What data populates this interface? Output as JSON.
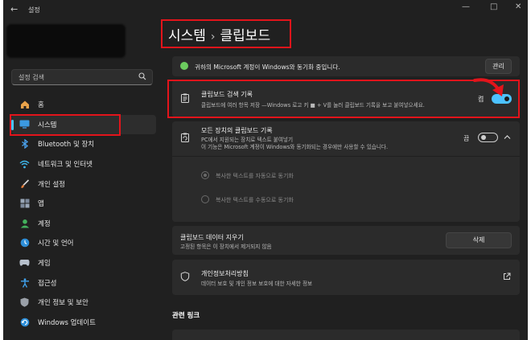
{
  "window": {
    "back": "←",
    "title": "설정",
    "controls": [
      "—",
      "□",
      "✕"
    ]
  },
  "search": {
    "placeholder": "설정 검색"
  },
  "sidebar": {
    "items": [
      {
        "label": "홈",
        "icon": "home-icon"
      },
      {
        "label": "시스템",
        "icon": "system-icon",
        "active": true
      },
      {
        "label": "Bluetooth 및 장치",
        "icon": "bluetooth-icon"
      },
      {
        "label": "네트워크 및 인터넷",
        "icon": "network-icon"
      },
      {
        "label": "개인 설정",
        "icon": "brush-icon"
      },
      {
        "label": "앱",
        "icon": "apps-icon"
      },
      {
        "label": "계정",
        "icon": "account-icon"
      },
      {
        "label": "시간 및 언어",
        "icon": "time-language-icon"
      },
      {
        "label": "게임",
        "icon": "gaming-icon"
      },
      {
        "label": "접근성",
        "icon": "accessibility-icon"
      },
      {
        "label": "개인 정보 및 보안",
        "icon": "shield-icon"
      },
      {
        "label": "Windows 업데이트",
        "icon": "windows-update-icon"
      }
    ]
  },
  "breadcrumb": {
    "parent": "시스템",
    "separator": "›",
    "current": "클립보드"
  },
  "banner": {
    "text": "귀하의 Microsoft 계정이 Windows와 동기화 중입니다.",
    "button": "관리"
  },
  "clipboard_history": {
    "title": "클립보드 검색 기록",
    "subtitle": "클립보드에 여러 항목 저장 —Windows 로고 키 ■ + V를 눌러 클립보드 기록을 보고 붙여넣으세요.",
    "state": "켬",
    "on": true
  },
  "sync_devices": {
    "title": "모든 장치의 클립보드 기록",
    "subtitle1": "PC에서 지원되는 장치로 텍스트 붙여넣기",
    "subtitle2": "이 기능은 Microsoft 계정이 Windows와 동기화되는 경우에만 사용할 수 있습니다.",
    "state": "끔",
    "on": false,
    "options": [
      "복사한 텍스트를 자동으로 동기화",
      "복사한 텍스트를 수동으로 동기화"
    ]
  },
  "clear_data": {
    "title": "클립보드 데이터 지우기",
    "subtitle": "고정된 항목은 이 장치에서 제거되지 않음",
    "button": "삭제"
  },
  "privacy": {
    "title": "개인정보처리방침",
    "subtitle": "데이터 보호 및 개인 정보 보호에 대한 자세한 정보"
  },
  "related": {
    "heading": "관련 링크"
  },
  "colors": {
    "accent": "#4cc2ff",
    "annotation": "#e3141b",
    "success": "#6ccb5f",
    "background": "#202020",
    "card": "#2b2b2b"
  }
}
